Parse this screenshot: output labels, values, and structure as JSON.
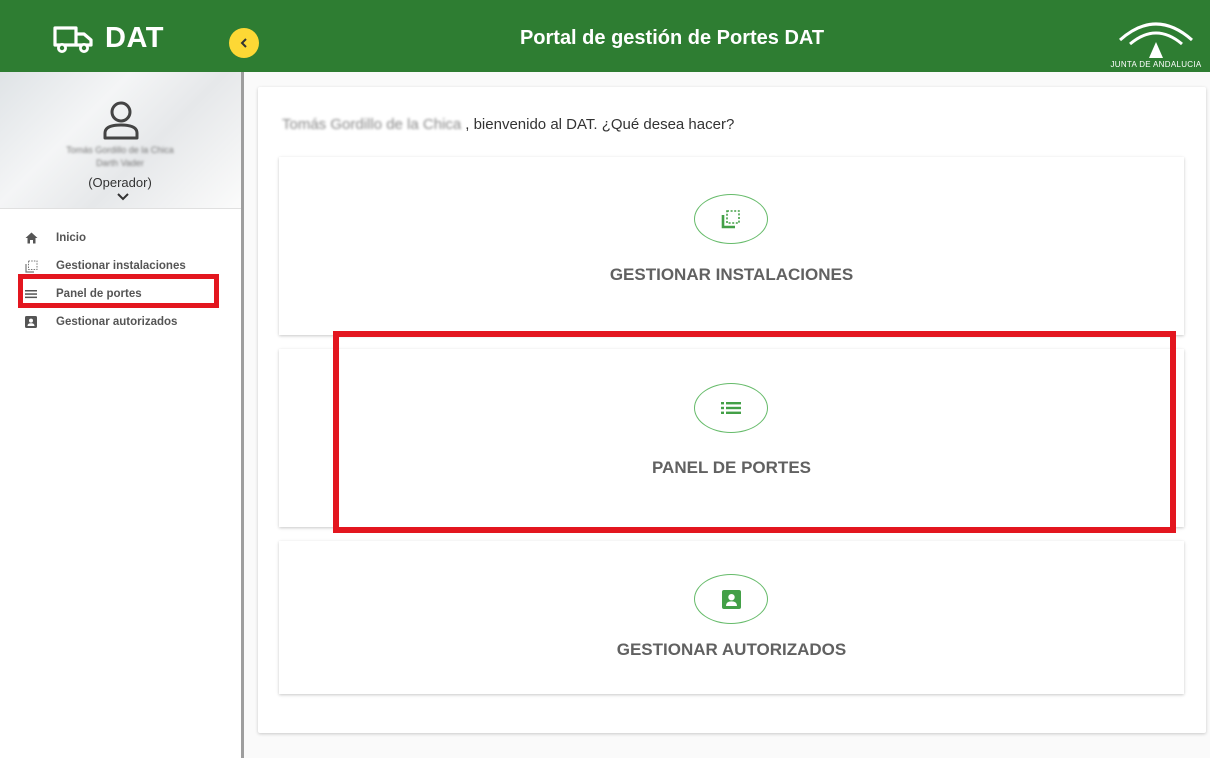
{
  "header": {
    "brand": "DAT",
    "title": "Portal de gestión de Portes DAT",
    "logo_text": "JUNTA DE ANDALUCIA",
    "color": "#2e7d32",
    "accent": "#fdd835"
  },
  "profile": {
    "name": "Tomás Gordillo de la Chica",
    "subtitle": "Darth Vader",
    "role": "(Operador)"
  },
  "sidebar": {
    "items": [
      {
        "label": "Inicio",
        "icon": "home-icon"
      },
      {
        "label": "Gestionar instalaciones",
        "icon": "installations-icon"
      },
      {
        "label": "Panel de portes",
        "icon": "list-icon"
      },
      {
        "label": "Gestionar autorizados",
        "icon": "badge-icon"
      }
    ]
  },
  "main": {
    "welcome_name": "Tomás Gordillo de la Chica",
    "welcome_text": ", bienvenido al DAT. ¿Qué desea hacer?",
    "actions": [
      {
        "label": "GESTIONAR INSTALACIONES",
        "icon": "installations-icon"
      },
      {
        "label": "PANEL DE PORTES",
        "icon": "list-icon"
      },
      {
        "label": "GESTIONAR AUTORIZADOS",
        "icon": "badge-icon"
      }
    ]
  },
  "highlight_color": "#e3161f"
}
